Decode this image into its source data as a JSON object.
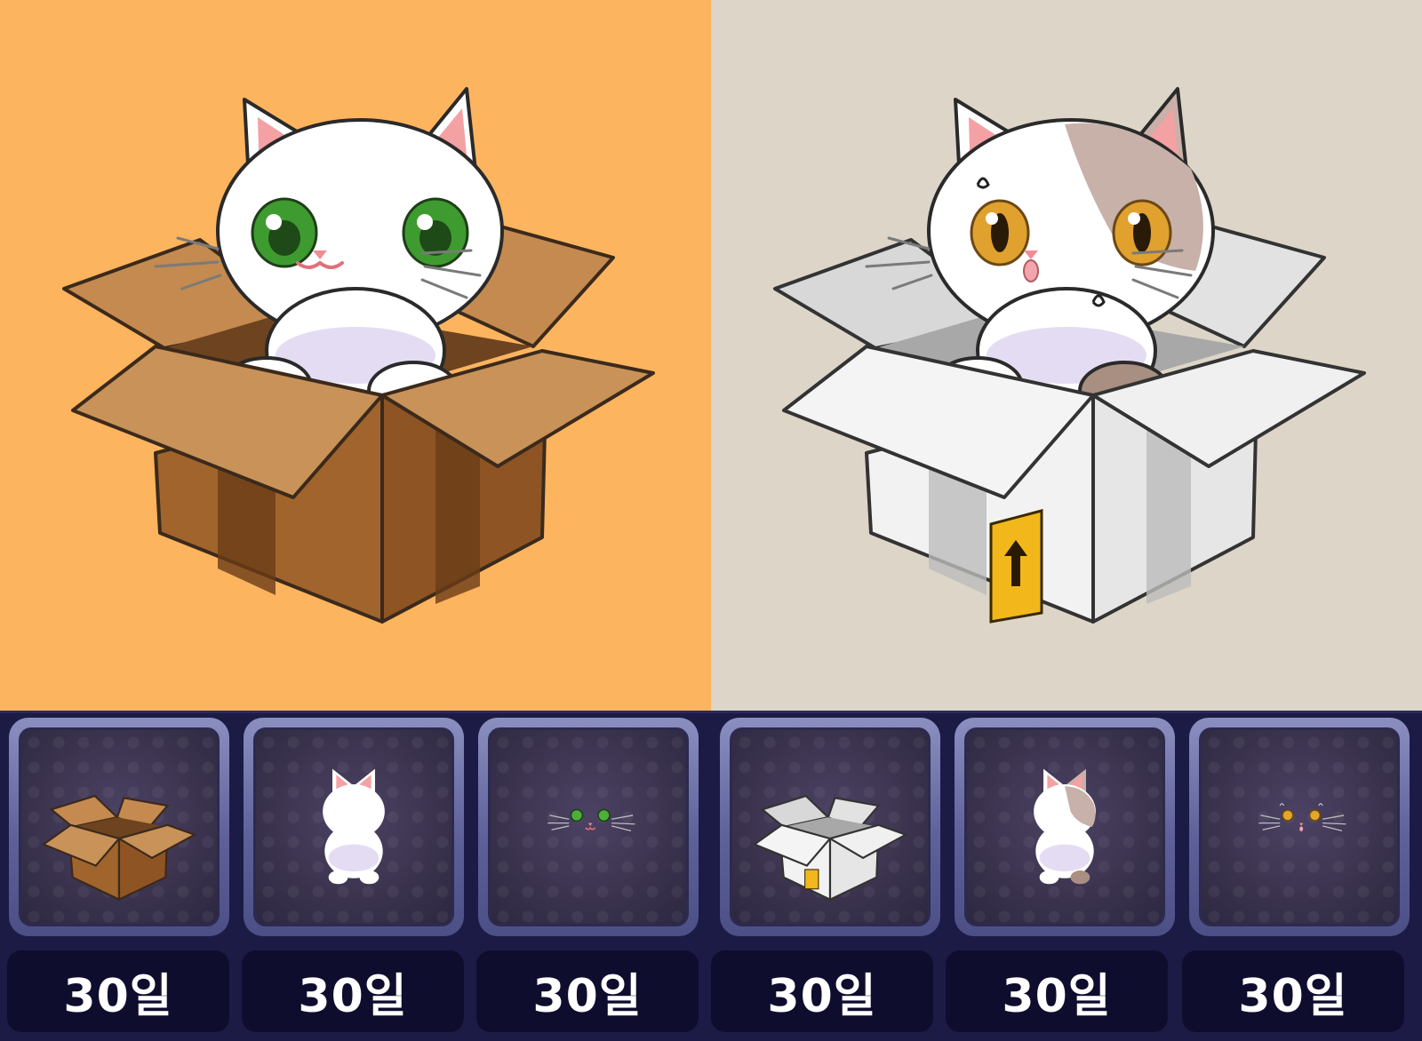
{
  "previews": [
    {
      "name": "brown-box-white-cat",
      "background": "#fdb45f",
      "box": "brown",
      "cat": "white"
    },
    {
      "name": "white-box-calico-cat",
      "background": "#ddd6c8",
      "box": "white",
      "cat": "calico"
    }
  ],
  "inventory": {
    "slots": [
      {
        "icon": "brown-box-icon",
        "duration": "30일"
      },
      {
        "icon": "white-cat-icon",
        "duration": "30일"
      },
      {
        "icon": "green-eyes-face-icon",
        "duration": "30일"
      },
      {
        "icon": "white-box-icon",
        "duration": "30일"
      },
      {
        "icon": "calico-cat-icon",
        "duration": "30일"
      },
      {
        "icon": "amber-eyes-face-icon",
        "duration": "30일"
      }
    ]
  },
  "colors": {
    "strip_bg": "#1c1b45",
    "slot_frame": "#6c6fa8",
    "label_bg": "#0f0d2e",
    "brown_box": "#b87a3e",
    "white_box": "#dedede",
    "cat_green_eyes": "#4caf3a",
    "cat_amber_eyes": "#e3a72a"
  }
}
